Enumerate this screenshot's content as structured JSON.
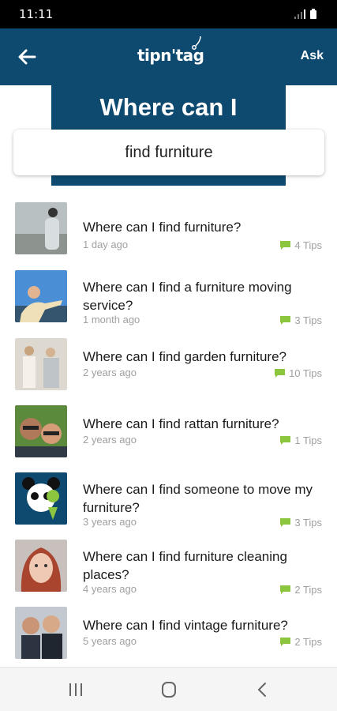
{
  "status_bar": {
    "time": "11:11"
  },
  "header": {
    "logo_text": "tipn'tag",
    "ask_label": "Ask"
  },
  "hero": {
    "title": "Where can I"
  },
  "search": {
    "value": "find furniture",
    "placeholder": ""
  },
  "questions": [
    {
      "title": "Where can I find furniture?",
      "time": "1 day ago",
      "tips": "4 Tips",
      "avatar": "person-on-hill-photo"
    },
    {
      "title": "Where can I find a furniture moving service?",
      "time": "1 month ago",
      "tips": "3 Tips",
      "avatar": "woman-blue-sky-photo"
    },
    {
      "title": "Where can I find garden furniture?",
      "time": "2 years ago",
      "tips": "10 Tips",
      "avatar": "two-people-photo"
    },
    {
      "title": "Where can I find rattan furniture?",
      "time": "2 years ago",
      "tips": "1 Tips",
      "avatar": "couple-selfie-photo"
    },
    {
      "title": "Where can I find someone to move my furniture?",
      "time": "3 years ago",
      "tips": "3 Tips",
      "avatar": "panda-logo"
    },
    {
      "title": "Where can I find furniture cleaning places?",
      "time": "4 years ago",
      "tips": "2 Tips",
      "avatar": "redhead-woman-photo"
    },
    {
      "title": "Where can I find vintage furniture?",
      "time": "5 years ago",
      "tips": "2 Tips",
      "avatar": "two-men-photo"
    }
  ],
  "colors": {
    "brand": "#0e4a6f",
    "tip_icon": "#8cc63f",
    "muted_text": "#a0a0a0"
  }
}
